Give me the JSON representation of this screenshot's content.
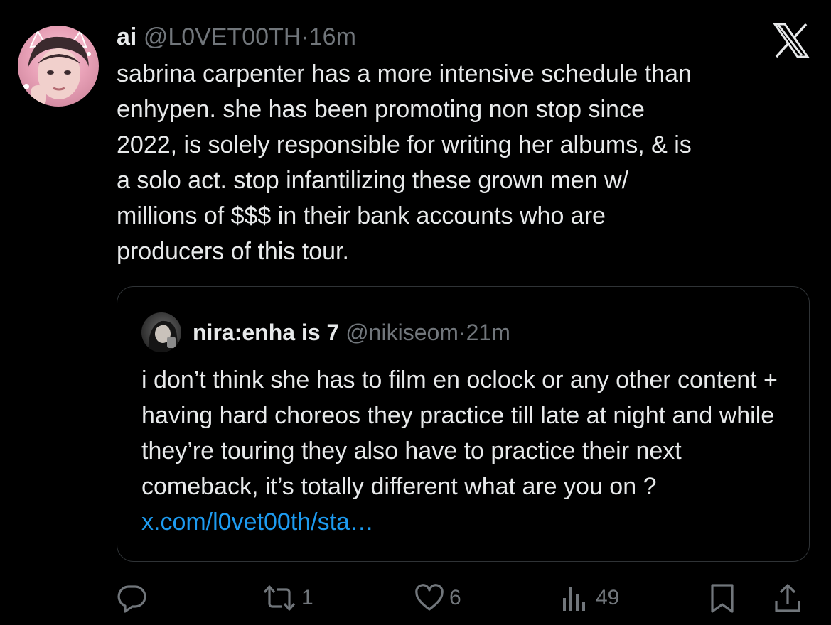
{
  "tweet": {
    "author_name": "ai",
    "handle": "@L0VET00TH",
    "separator": "·",
    "time": "16m",
    "text": "sabrina carpenter has a more intensive schedule than\nenhypen. she has been promoting non stop since\n2022, is solely responsible for writing her albums, & is\na solo act. stop infantilizing these grown men w/\nmillions of $$$ in their bank accounts who are\nproducers of this tour."
  },
  "quote": {
    "author_name": "nira:enha is 7",
    "handle": "@nikiseom",
    "separator": "·",
    "time": "21m",
    "text": "i don’t think she has to film en oclock or any other content + having hard choreos they practice till late at night and while they’re touring they also have to practice their next comeback, it’s totally different what are you on ? ",
    "link": "x.com/l0vet00th/sta…"
  },
  "actions": {
    "reply": {
      "icon": "reply-icon"
    },
    "repost": {
      "icon": "repost-icon",
      "count": "1"
    },
    "like": {
      "icon": "heart-icon",
      "count": "6"
    },
    "views": {
      "icon": "views-icon",
      "count": "49"
    },
    "bookmark": {
      "icon": "bookmark-icon"
    },
    "share": {
      "icon": "share-icon"
    }
  },
  "icons": {
    "logo": "x-logo-icon"
  },
  "colors": {
    "background": "#000000",
    "text": "#e7e9ea",
    "muted": "#71767b",
    "link": "#1d9bf0",
    "border": "#2f3336"
  }
}
